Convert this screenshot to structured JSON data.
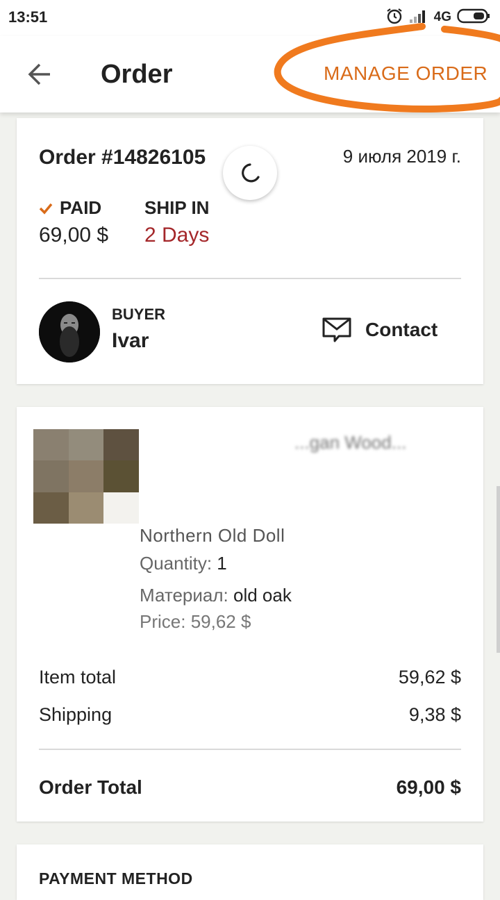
{
  "status_bar": {
    "time": "13:51",
    "network": "4G"
  },
  "header": {
    "title": "Order",
    "manage_label": "MANAGE ORDER"
  },
  "order": {
    "number": "Order #14826105",
    "date": "9 июля 2019 г.",
    "paid_label": "PAID",
    "paid_amount": "69,00 $",
    "ship_label": "SHIP IN",
    "ship_value": "2 Days"
  },
  "buyer": {
    "label": "BUYER",
    "name": "Ivar",
    "contact_label": "Contact"
  },
  "item": {
    "title_partial": "...gan Wood...",
    "title": "Northern  Old Doll",
    "quantity_label": "Quantity:",
    "quantity_value": "1",
    "material_label": "Материал:",
    "material_value": "old oak",
    "price_label": "Price:",
    "price_value": "59,62 $"
  },
  "summary": {
    "item_total_label": "Item total",
    "item_total_value": "59,62 $",
    "shipping_label": "Shipping",
    "shipping_value": "9,38 $",
    "order_total_label": "Order Total",
    "order_total_value": "69,00 $"
  },
  "payment": {
    "title": "PAYMENT METHOD"
  },
  "colors": {
    "accent": "#d96b19",
    "ship_red": "#a4272a",
    "background": "#f1f2ee"
  }
}
